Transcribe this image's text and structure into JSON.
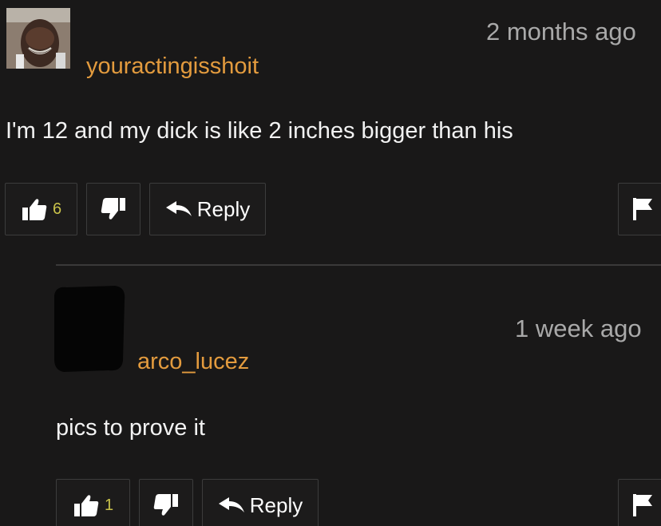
{
  "comments": [
    {
      "username": "youractingisshoit",
      "timestamp": "2 months ago",
      "text": "I'm 12 and my dick is like 2 inches bigger than his",
      "likes": "6",
      "reply_label": "Reply"
    },
    {
      "username": "arco_lucez",
      "timestamp": "1 week ago",
      "text": "pics to prove it",
      "likes": "1",
      "reply_label": "Reply"
    }
  ],
  "icons": {
    "like": "thumbs-up-icon",
    "dislike": "thumbs-down-icon",
    "reply": "reply-arrow-icon",
    "flag": "flag-icon"
  },
  "colors": {
    "background": "#191818",
    "username": "#e39b3e",
    "timestamp": "#a9a9a9",
    "text": "#f2f2f2",
    "like_count": "#c9c24a"
  }
}
